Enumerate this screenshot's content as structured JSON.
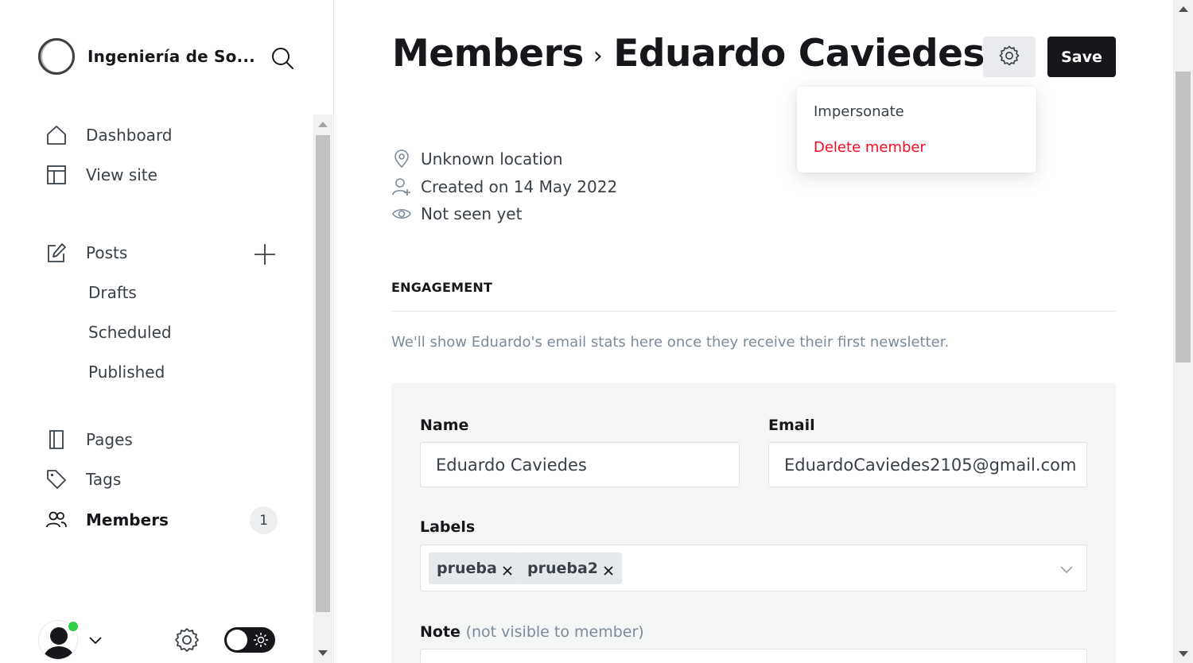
{
  "sidebar": {
    "site_title": "Ingeniería de So...",
    "nav": {
      "dashboard": "Dashboard",
      "view_site": "View site",
      "posts": "Posts",
      "drafts": "Drafts",
      "scheduled": "Scheduled",
      "published": "Published",
      "pages": "Pages",
      "tags": "Tags",
      "members": "Members",
      "members_count": "1"
    },
    "icons": [
      "site-logo",
      "search-icon",
      "home-icon",
      "layout-icon",
      "edit-icon",
      "plus-icon",
      "page-icon",
      "tag-icon",
      "members-icon",
      "user-avatar",
      "chevron-down-icon",
      "gear-icon",
      "sun-icon"
    ],
    "user_online": true,
    "theme": "light"
  },
  "header": {
    "breadcrumb_parent": "Members",
    "breadcrumb_separator": "›",
    "member_name": "Eduardo Caviedes",
    "save_label": "Save"
  },
  "dropdown": {
    "impersonate": "Impersonate",
    "delete_member": "Delete member"
  },
  "meta": {
    "location": "Unknown location",
    "created": "Created on 14 May 2022",
    "last_seen": "Not seen yet"
  },
  "engagement": {
    "heading": "ENGAGEMENT",
    "note": "We'll show Eduardo's email stats here once they receive their first newsletter."
  },
  "form": {
    "name_label": "Name",
    "name_value": "Eduardo Caviedes",
    "email_label": "Email",
    "email_value": "EduardoCaviedes2105@gmail.com",
    "labels_label": "Labels",
    "labels": [
      "prueba",
      "prueba2"
    ],
    "note_label": "Note",
    "note_hint": "(not visible to member)"
  },
  "colors": {
    "primary": "#15171a",
    "danger": "#f50b23",
    "online": "#30cf43",
    "muted": "#7c8b9a",
    "card_bg": "#f4f5f5"
  }
}
